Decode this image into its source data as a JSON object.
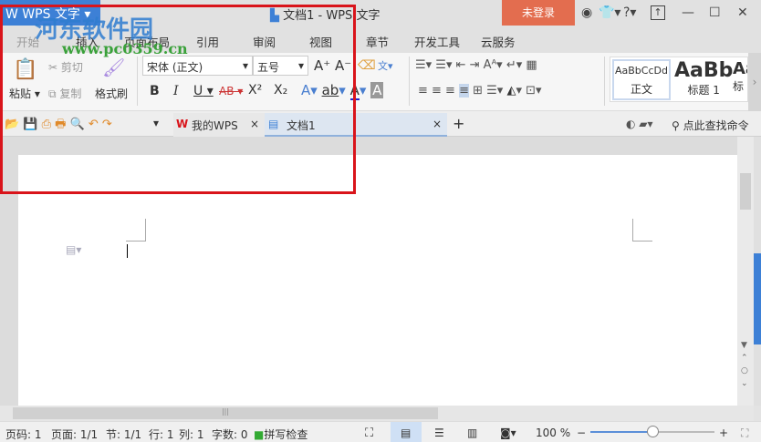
{
  "title_bar": {
    "app_menu": "WPS 文字",
    "doc_title": "文档1 - WPS 文字",
    "login": "未登录"
  },
  "menu_tabs": [
    "开始",
    "插入",
    "页面布局",
    "引用",
    "审阅",
    "视图",
    "章节",
    "开发工具",
    "云服务"
  ],
  "ribbon": {
    "paste": "粘贴",
    "cut": "剪切",
    "copy": "复制",
    "format_painter": "格式刷",
    "font_name": "宋体 (正文)",
    "font_size": "五号",
    "bold": "B",
    "italic": "I",
    "underline": "U",
    "strike": "AB",
    "superscript": "X²",
    "subscript": "X₂",
    "styles": [
      {
        "preview": "AaBbCcDd",
        "label": "正文"
      },
      {
        "preview": "AaBb",
        "label": "标题 1"
      },
      {
        "preview": "Aa",
        "label": "标"
      }
    ]
  },
  "doc_tabs": {
    "my_wps": "我的WPS",
    "doc": "文档1",
    "search": "点此查找命令"
  },
  "watermark": {
    "name": "河东软件园",
    "url": "www.pc0359.cn"
  },
  "status": {
    "page": "页码: 1",
    "pages": "页面: 1/1",
    "section": "节: 1/1",
    "row": "行: 1",
    "col": "列: 1",
    "words": "字数: 0",
    "spell": "拼写检查",
    "zoom": "100 %",
    "zoom_level": 0.5
  },
  "colors": {
    "accent": "#3d80d6",
    "login": "#e36d4f",
    "annotation": "#d9141b"
  }
}
